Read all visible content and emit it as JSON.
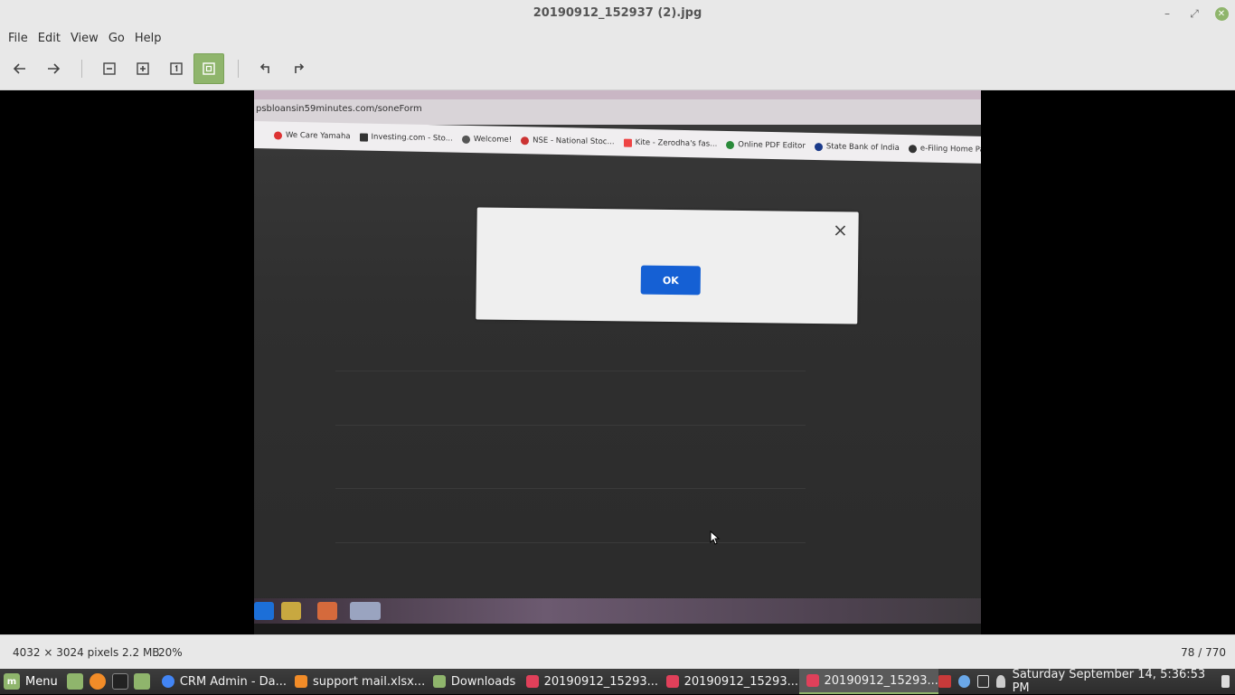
{
  "window": {
    "title": "20190912_152937 (2).jpg",
    "controls": {
      "minimize": "–",
      "maximize": "⤢",
      "close": "✕"
    }
  },
  "menu": [
    "File",
    "Edit",
    "View",
    "Go",
    "Help"
  ],
  "toolbar": {
    "buttons": [
      {
        "name": "back",
        "icon": "arrow-left-icon"
      },
      {
        "name": "forward",
        "icon": "arrow-right-icon"
      },
      {
        "name": "zoom-out",
        "icon": "zoom-out-icon"
      },
      {
        "name": "zoom-in",
        "icon": "zoom-in-icon"
      },
      {
        "name": "normal-size",
        "icon": "one-to-one-icon"
      },
      {
        "name": "best-fit",
        "icon": "fit-icon",
        "active": true
      },
      {
        "name": "rotate-left",
        "icon": "rotate-ccw-icon"
      },
      {
        "name": "rotate-right",
        "icon": "rotate-cw-icon"
      }
    ]
  },
  "photo": {
    "url": "psbloansin59minutes.com/soneForm",
    "bookmarks": [
      "We Care Yamaha",
      "Investing.com - Sto...",
      "Welcome!",
      "NSE - National Stoc...",
      "Kite - Zerodha's fas...",
      "Online PDF Editor",
      "State Bank of India",
      "e-Filing Home Page..."
    ],
    "dialog": {
      "ok_label": "OK",
      "close_glyph": "×"
    }
  },
  "status": {
    "info": "4032 × 3024 pixels  2.2 MB",
    "zoom": "20%",
    "count": "78 / 770"
  },
  "panel": {
    "menu_label": "Menu",
    "tasks": [
      {
        "label": "CRM Admin - Da...",
        "color": "#4285f4"
      },
      {
        "label": "support mail.xlsx...",
        "color": "#f28c28"
      },
      {
        "label": "Downloads",
        "color": "#8fb56c"
      },
      {
        "label": "20190912_15293...",
        "color": "#e0405a"
      },
      {
        "label": "20190912_15293...",
        "color": "#e0405a"
      },
      {
        "label": "20190912_15293...",
        "color": "#e0405a",
        "active": true
      }
    ],
    "clock": "Saturday September 14,  5:36:53 PM"
  },
  "colors": {
    "accent": "#8fb56c",
    "ok_button": "#1560d4"
  }
}
